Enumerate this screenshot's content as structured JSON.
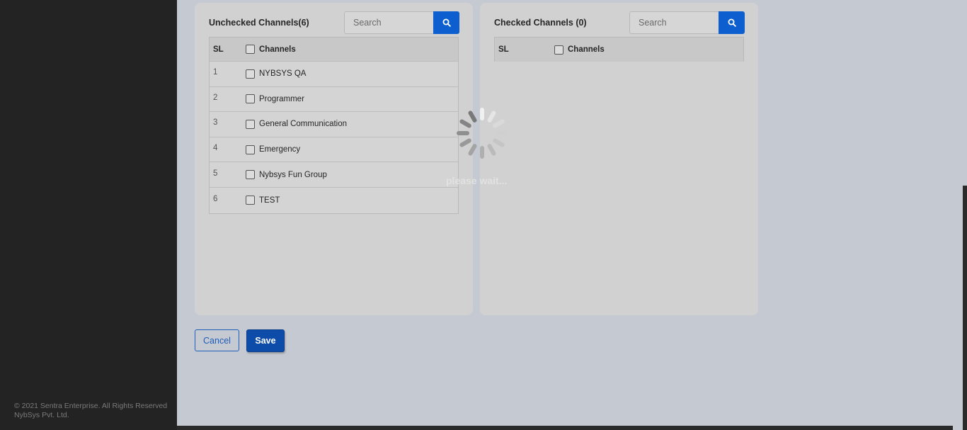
{
  "footer": {
    "line1": "© 2021 Sentra Enterprise. All Rights Reserved",
    "line2": "NybSys Pvt. Ltd."
  },
  "unchecked": {
    "title": "Unchecked Channels(6)",
    "search_placeholder": "Search",
    "col_sl": "SL",
    "col_channels": "Channels",
    "rows": [
      {
        "sl": "1",
        "name": "NYBSYS QA"
      },
      {
        "sl": "2",
        "name": "Programmer"
      },
      {
        "sl": "3",
        "name": "General Communication"
      },
      {
        "sl": "4",
        "name": "Emergency"
      },
      {
        "sl": "5",
        "name": "Nybsys Fun Group"
      },
      {
        "sl": "6",
        "name": "TEST"
      }
    ]
  },
  "checked": {
    "title": "Checked Channels (0)",
    "search_placeholder": "Search",
    "col_sl": "SL",
    "col_channels": "Channels"
  },
  "actions": {
    "cancel_label": "Cancel",
    "save_label": "Save"
  },
  "loading": {
    "text": "please wait..."
  },
  "icons": {
    "search": "search-icon",
    "spinner": "spinner-icon"
  },
  "colors": {
    "accent": "#0d5fcf",
    "sidebar": "#232323"
  }
}
